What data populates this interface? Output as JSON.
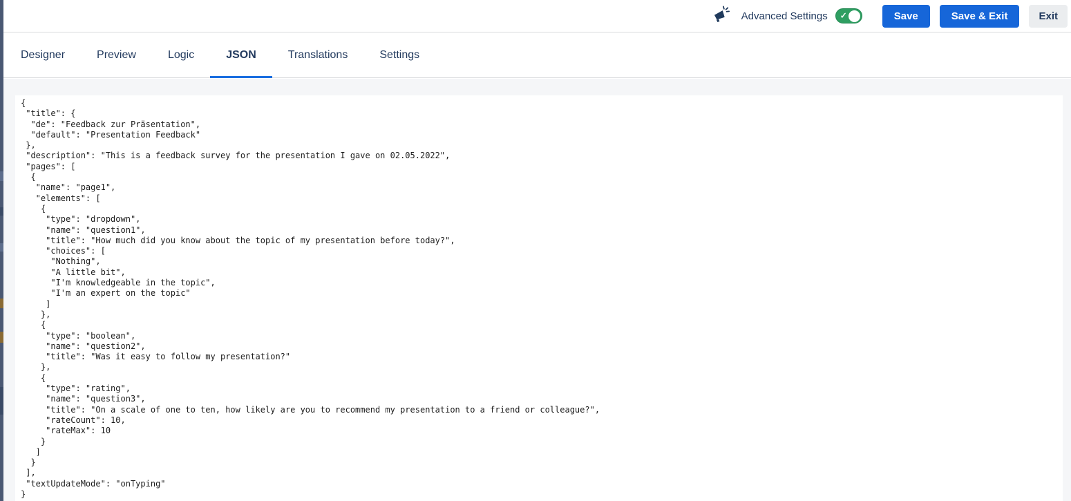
{
  "topbar": {
    "announcement_icon": "megaphone-icon",
    "advanced_settings_label": "Advanced Settings",
    "advanced_settings_on": true,
    "save_label": "Save",
    "save_exit_label": "Save & Exit",
    "exit_label": "Exit"
  },
  "tabs": [
    {
      "label": "Designer",
      "active": false
    },
    {
      "label": "Preview",
      "active": false
    },
    {
      "label": "Logic",
      "active": false
    },
    {
      "label": "JSON",
      "active": true
    },
    {
      "label": "Translations",
      "active": false
    },
    {
      "label": "Settings",
      "active": false
    }
  ],
  "editor": {
    "language": "json",
    "text": "{\n \"title\": {\n  \"de\": \"Feedback zur Präsentation\",\n  \"default\": \"Presentation Feedback\"\n },\n \"description\": \"This is a feedback survey for the presentation I gave on 02.05.2022\",\n \"pages\": [\n  {\n   \"name\": \"page1\",\n   \"elements\": [\n    {\n     \"type\": \"dropdown\",\n     \"name\": \"question1\",\n     \"title\": \"How much did you know about the topic of my presentation before today?\",\n     \"choices\": [\n      \"Nothing\",\n      \"A little bit\",\n      \"I'm knowledgeable in the topic\",\n      \"I'm an expert on the topic\"\n     ]\n    },\n    {\n     \"type\": \"boolean\",\n     \"name\": \"question2\",\n     \"title\": \"Was it easy to follow my presentation?\"\n    },\n    {\n     \"type\": \"rating\",\n     \"name\": \"question3\",\n     \"title\": \"On a scale of one to ten, how likely are you to recommend my presentation to a friend or colleague?\",\n     \"rateCount\": 10,\n     \"rateMax\": 10\n    }\n   ]\n  }\n ],\n \"textUpdateMode\": \"onTyping\"\n}"
  },
  "colors": {
    "accent_blue": "#1666d9",
    "tab_underline_blue": "#1a6ee0",
    "toggle_green": "#2e9e61",
    "navy_text": "#223a5e",
    "content_bg": "#f5f6f8",
    "edge_strip": "#4a5873"
  }
}
